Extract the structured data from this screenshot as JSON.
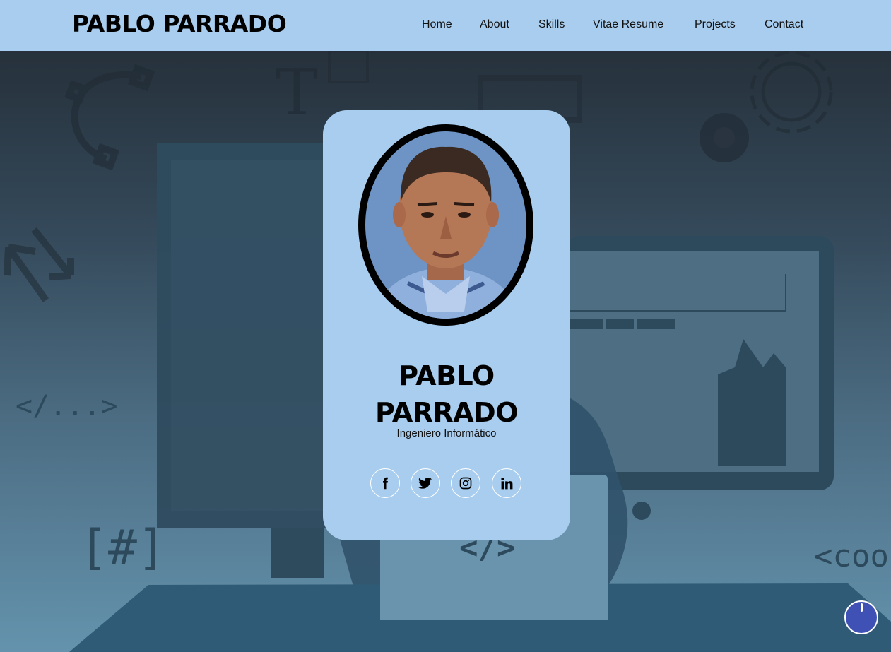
{
  "navbar": {
    "brand": "PABLO PARRADO",
    "links": [
      "Home",
      "About",
      "Skills",
      "Vitae Resume",
      "Projects",
      "Contact"
    ]
  },
  "background": {
    "code_glyphs": [
      "</...>",
      "[#]",
      "</>",
      "<coo"
    ],
    "type_glyph": "T"
  },
  "profile": {
    "name_line1": "PABLO",
    "name_line2": "PARRADO",
    "role": "Ingeniero Informático"
  },
  "social": {
    "icons": [
      "facebook-icon",
      "twitter-icon",
      "instagram-icon",
      "linkedin-icon"
    ]
  },
  "colors": {
    "navbar_bg": "#a8cdee",
    "card_bg": "#a8cdee",
    "hero_top": "#26313b",
    "hero_bottom": "#6493ad",
    "fab": "#3f51b5"
  }
}
